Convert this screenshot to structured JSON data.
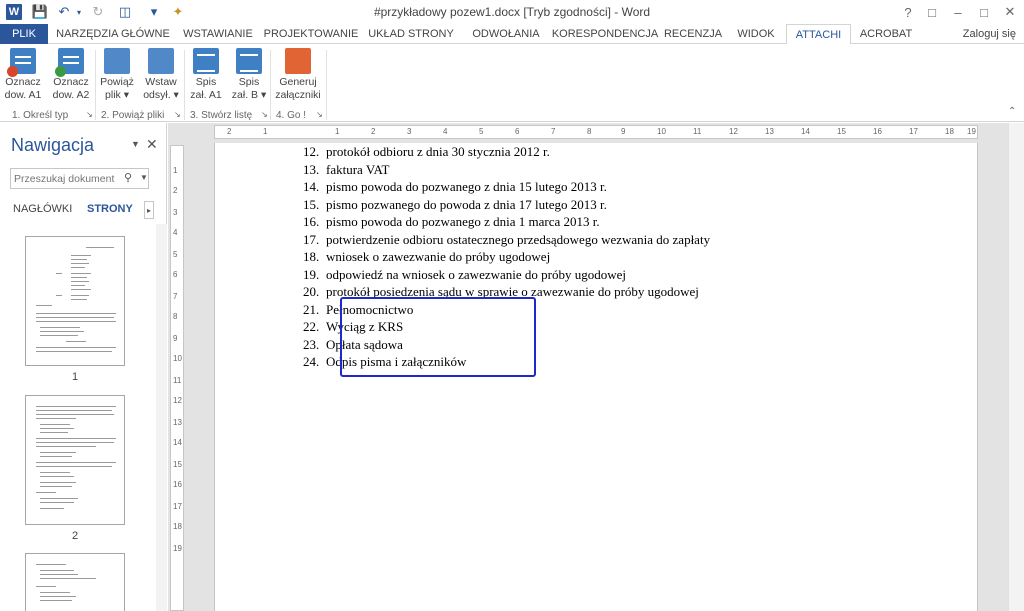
{
  "window": {
    "title": "#przykładowy pozew1.docx [Tryb zgodności] - Word",
    "app_icon_letter": "W"
  },
  "tabs": [
    "PLIK",
    "NARZĘDZIA GŁÓWNE",
    "WSTAWIANIE",
    "PROJEKTOWANIE",
    "UKŁAD STRONY",
    "ODWOŁANIA",
    "KORESPONDENCJA",
    "RECENZJA",
    "WIDOK",
    "ATTACHI",
    "ACROBAT"
  ],
  "active_tab": "ATTACHI",
  "login_label": "Zaloguj się",
  "ribbon": {
    "buttons": [
      {
        "line1": "Oznacz",
        "line2": "dow. A1"
      },
      {
        "line1": "Oznacz",
        "line2": "dow. A2"
      },
      {
        "line1": "Powiąż",
        "line2": "plik ▾"
      },
      {
        "line1": "Wstaw",
        "line2": "odsył. ▾"
      },
      {
        "line1": "Spis",
        "line2": "zał. A1"
      },
      {
        "line1": "Spis",
        "line2": "zał. B ▾"
      },
      {
        "line1": "Generuj",
        "line2": "załączniki"
      }
    ],
    "groups": [
      "1. Określ typ",
      "2. Powiąż pliki",
      "3. Stwórz listę",
      "4. Go !"
    ]
  },
  "navigation": {
    "title": "Nawigacja",
    "search_placeholder": "Przeszukaj dokument",
    "tab_headings": "NAGŁÓWKI",
    "tab_pages": "STRONY",
    "page_numbers": [
      "1",
      "2"
    ]
  },
  "ruler": {
    "horizontal_labels": [
      "2",
      "1",
      "1",
      "2",
      "3",
      "4",
      "5",
      "6",
      "7",
      "8",
      "9",
      "10",
      "11",
      "12",
      "13",
      "14",
      "15",
      "16",
      "17",
      "18",
      "19"
    ],
    "vertical_labels": [
      "1",
      "2",
      "3",
      "4",
      "5",
      "6",
      "7",
      "8",
      "9",
      "10",
      "11",
      "12",
      "13",
      "14",
      "15",
      "16",
      "17",
      "18",
      "19"
    ]
  },
  "document": {
    "items": [
      {
        "num": "12.",
        "text": "protokół odbioru z dnia 30 stycznia 2012 r."
      },
      {
        "num": "13.",
        "text": "faktura VAT"
      },
      {
        "num": "14.",
        "text": "pismo powoda do pozwanego z dnia 15 lutego 2013 r."
      },
      {
        "num": "15.",
        "text": "pismo pozwanego do powoda z dnia 17 lutego 2013 r."
      },
      {
        "num": "16.",
        "text": "pismo powoda do pozwanego z dnia 1 marca 2013 r."
      },
      {
        "num": "17.",
        "text": "potwierdzenie odbioru ostatecznego przedsądowego wezwania do zapłaty"
      },
      {
        "num": "18.",
        "text": "wniosek o zawezwanie do próby ugodowej"
      },
      {
        "num": "19.",
        "text": "odpowiedź na wniosek o zawezwanie do próby ugodowej"
      },
      {
        "num": "20.",
        "text": "protokół posiedzenia sądu w sprawie o zawezwanie do próby ugodowej"
      },
      {
        "num": "21.",
        "text": "Pełnomocnictwo"
      },
      {
        "num": "22.",
        "text": "Wyciąg z KRS"
      },
      {
        "num": "23.",
        "text": "Opłata sądowa"
      },
      {
        "num": "24.",
        "text": "Odpis pisma i załączników"
      }
    ],
    "highlight_color": "#1f28c8"
  },
  "colors": {
    "accent": "#2b579a"
  }
}
